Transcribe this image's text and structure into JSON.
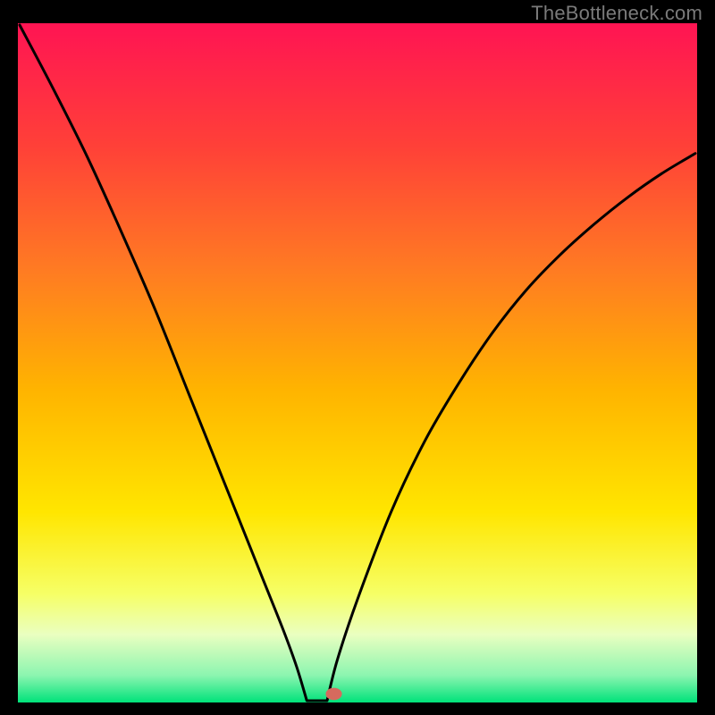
{
  "watermark": "TheBottleneck.com",
  "colors": {
    "frame_bg": "#000000",
    "curve_stroke": "#000000",
    "marker_fill": "#d66a5e",
    "gradient_stops": [
      {
        "offset": 0.0,
        "color": "#ff1453"
      },
      {
        "offset": 0.18,
        "color": "#ff4038"
      },
      {
        "offset": 0.36,
        "color": "#ff7a23"
      },
      {
        "offset": 0.54,
        "color": "#ffb400"
      },
      {
        "offset": 0.72,
        "color": "#ffe600"
      },
      {
        "offset": 0.84,
        "color": "#f6ff66"
      },
      {
        "offset": 0.9,
        "color": "#eaffc0"
      },
      {
        "offset": 0.96,
        "color": "#8cf5b0"
      },
      {
        "offset": 1.0,
        "color": "#00e27a"
      }
    ]
  },
  "chart_data": {
    "type": "line",
    "title": "",
    "xlabel": "",
    "ylabel": "",
    "xlim": [
      0,
      1
    ],
    "ylim": [
      0,
      1
    ],
    "notch_x": 0.455,
    "flat_start_x": 0.425,
    "flat_end_x": 0.455,
    "flat_y": 0.0,
    "marker": {
      "x": 0.465,
      "y": 0.01,
      "rx": 0.012,
      "ry": 0.009
    },
    "series": [
      {
        "name": "left",
        "x": [
          0.0,
          0.05,
          0.1,
          0.15,
          0.2,
          0.25,
          0.3,
          0.33,
          0.36,
          0.39,
          0.41,
          0.425
        ],
        "values": [
          1.0,
          0.905,
          0.805,
          0.695,
          0.58,
          0.455,
          0.33,
          0.255,
          0.18,
          0.105,
          0.05,
          0.0
        ]
      },
      {
        "name": "flat",
        "x": [
          0.425,
          0.44,
          0.455
        ],
        "values": [
          0.0,
          0.0,
          0.0
        ]
      },
      {
        "name": "right",
        "x": [
          0.455,
          0.47,
          0.5,
          0.55,
          0.6,
          0.65,
          0.7,
          0.75,
          0.8,
          0.85,
          0.9,
          0.95,
          1.0
        ],
        "values": [
          0.0,
          0.06,
          0.15,
          0.28,
          0.385,
          0.47,
          0.545,
          0.608,
          0.66,
          0.705,
          0.745,
          0.78,
          0.81
        ]
      }
    ]
  }
}
